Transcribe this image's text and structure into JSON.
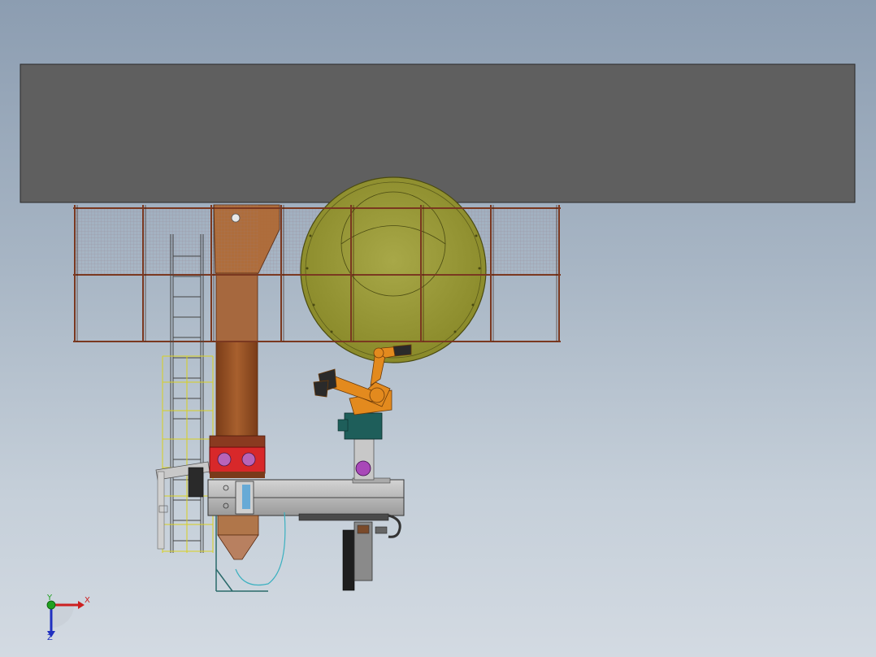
{
  "viewport": {
    "background_top": "#8c9db1",
    "background_bottom": "#d3dae2"
  },
  "model": {
    "roof_color": "#5f5f5f",
    "frame_color": "#8a4a2a",
    "tank_color": "#9a9a3a",
    "robot_color": "#e38a1e",
    "hopper_color": "#a05a2a",
    "accent_red": "#d8282a",
    "platform_color": "#b8b8b8"
  },
  "triad": {
    "x_label": "X",
    "y_label": "Y",
    "z_label": "Z",
    "x_color": "#cc2020",
    "y_color": "#20a020",
    "z_color": "#2030c0"
  }
}
